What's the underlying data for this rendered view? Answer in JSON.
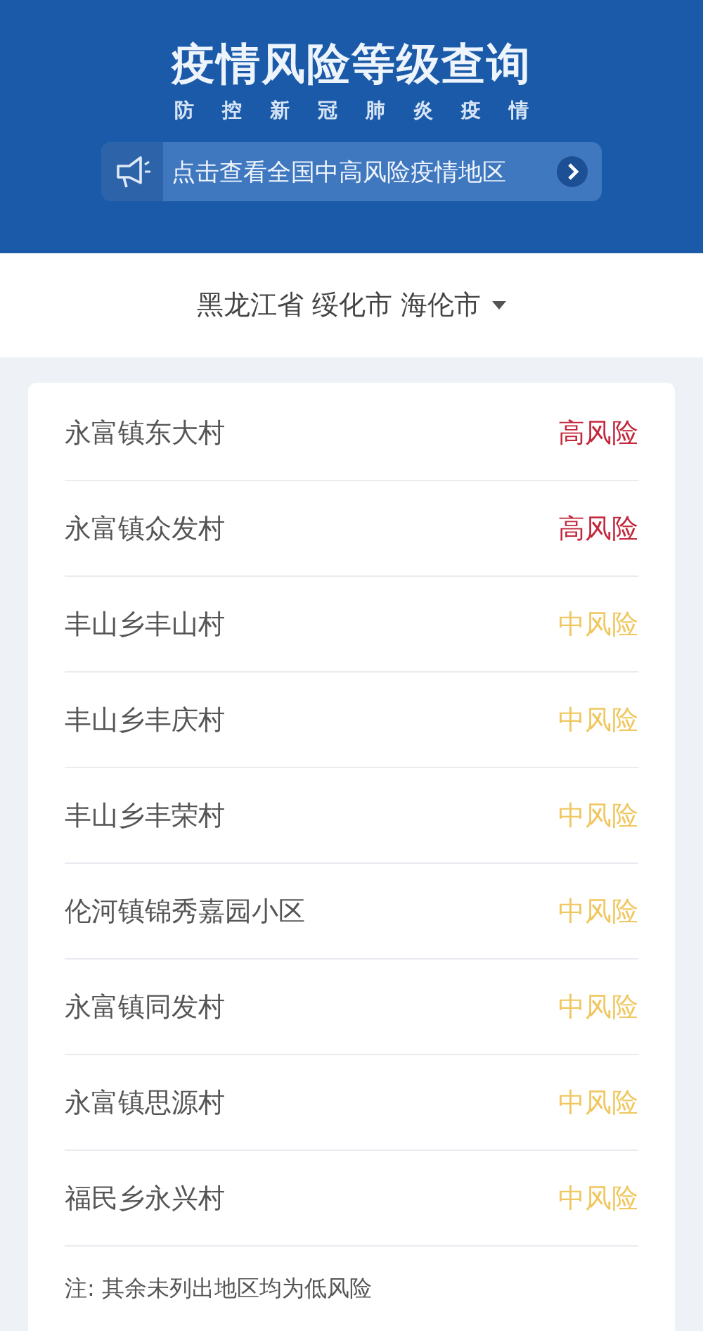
{
  "header": {
    "title": "疫情风险等级查询",
    "subtitle": [
      "防",
      "控",
      "新",
      "冠",
      "肺",
      "炎",
      "疫",
      "情"
    ],
    "notice": {
      "text": "点击查看全国中高风险疫情地区"
    }
  },
  "location": {
    "province": "黑龙江省",
    "city": "绥化市",
    "district": "海伦市"
  },
  "areas": [
    {
      "name": "永富镇东大村",
      "risk": "高风险",
      "kind": "high"
    },
    {
      "name": "永富镇众发村",
      "risk": "高风险",
      "kind": "high"
    },
    {
      "name": "丰山乡丰山村",
      "risk": "中风险",
      "kind": "medium"
    },
    {
      "name": "丰山乡丰庆村",
      "risk": "中风险",
      "kind": "medium"
    },
    {
      "name": "丰山乡丰荣村",
      "risk": "中风险",
      "kind": "medium"
    },
    {
      "name": "伦河镇锦秀嘉园小区",
      "risk": "中风险",
      "kind": "medium"
    },
    {
      "name": "永富镇同发村",
      "risk": "中风险",
      "kind": "medium"
    },
    {
      "name": "永富镇思源村",
      "risk": "中风险",
      "kind": "medium"
    },
    {
      "name": "福民乡永兴村",
      "risk": "中风险",
      "kind": "medium"
    }
  ],
  "note": "注: 其余未列出地区均为低风险"
}
